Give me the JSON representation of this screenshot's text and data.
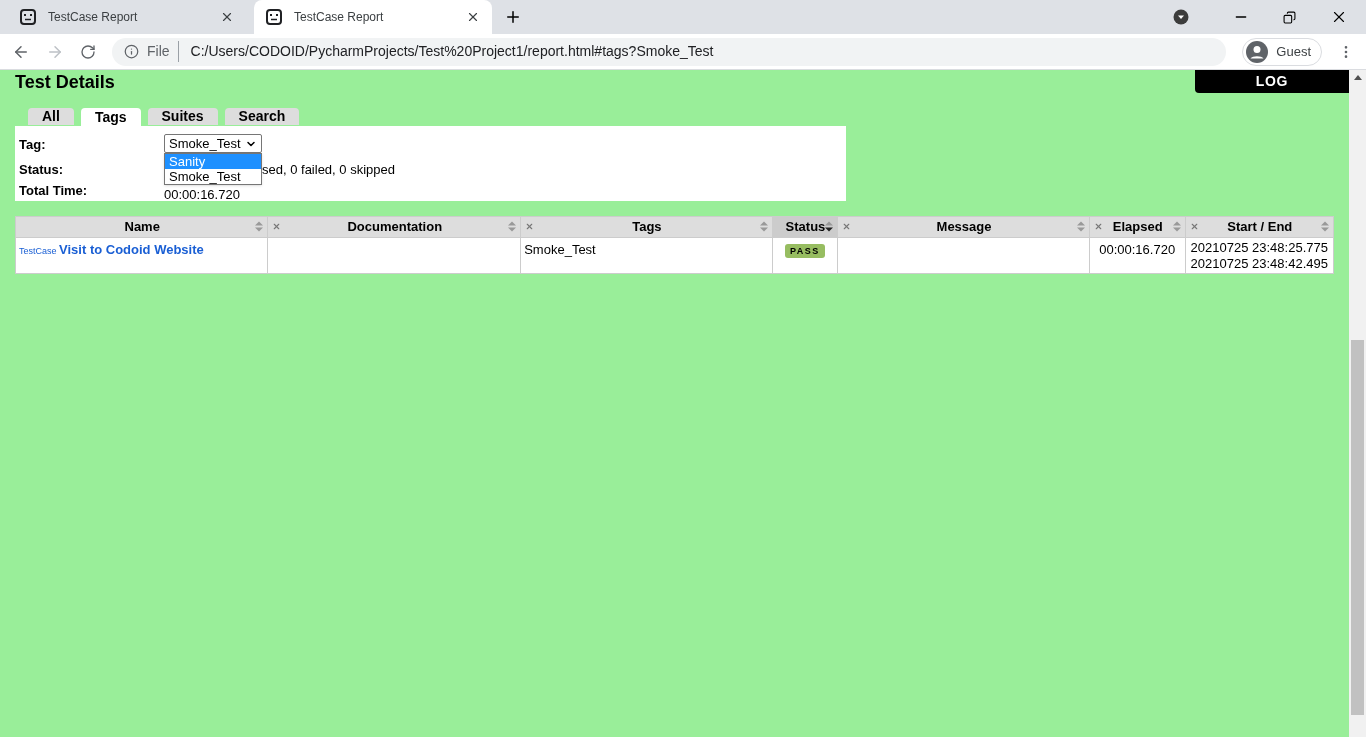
{
  "browser": {
    "tabs": [
      {
        "title": "TestCase Report",
        "selected": false
      },
      {
        "title": "TestCase Report",
        "selected": true
      }
    ],
    "address": {
      "scheme_label": "File",
      "url": "C:/Users/CODOID/PycharmProjects/Test%20Project1/report.html#tags?Smoke_Test"
    },
    "profile": "Guest"
  },
  "page": {
    "title": "Test Details",
    "log_button": "LOG",
    "view_tabs": [
      {
        "label": "All",
        "selected": false
      },
      {
        "label": "Tags",
        "selected": true
      },
      {
        "label": "Suites",
        "selected": false
      },
      {
        "label": "Search",
        "selected": false
      }
    ],
    "details": {
      "tag_label": "Tag:",
      "tag_select": {
        "value": "Smoke_Test",
        "open": true,
        "options": [
          {
            "label": "Sanity",
            "highlighted": true
          },
          {
            "label": "Smoke_Test",
            "highlighted": false
          }
        ]
      },
      "status_label": "Status:",
      "status_value": "sed, 0 failed, 0 skipped",
      "total_time_label": "Total Time:",
      "total_time_value": "00:00:16.720"
    },
    "table": {
      "columns": [
        {
          "name": "Name",
          "removable": false,
          "sorted": false
        },
        {
          "name": "Documentation",
          "removable": true,
          "sorted": false
        },
        {
          "name": "Tags",
          "removable": true,
          "sorted": false
        },
        {
          "name": "Status",
          "removable": false,
          "sorted": true
        },
        {
          "name": "Message",
          "removable": true,
          "sorted": false
        },
        {
          "name": "Elapsed",
          "removable": true,
          "sorted": false
        },
        {
          "name": "Start / End",
          "removable": true,
          "sorted": false
        }
      ],
      "rows": [
        {
          "name_prefix": "TestCase",
          "name": "Visit to Codoid Website",
          "tags": "Smoke_Test",
          "status": "PASS",
          "elapsed": "00:00:16.720",
          "start": "20210725 23:48:25.775",
          "end": "20210725 23:48:42.495"
        }
      ]
    }
  }
}
